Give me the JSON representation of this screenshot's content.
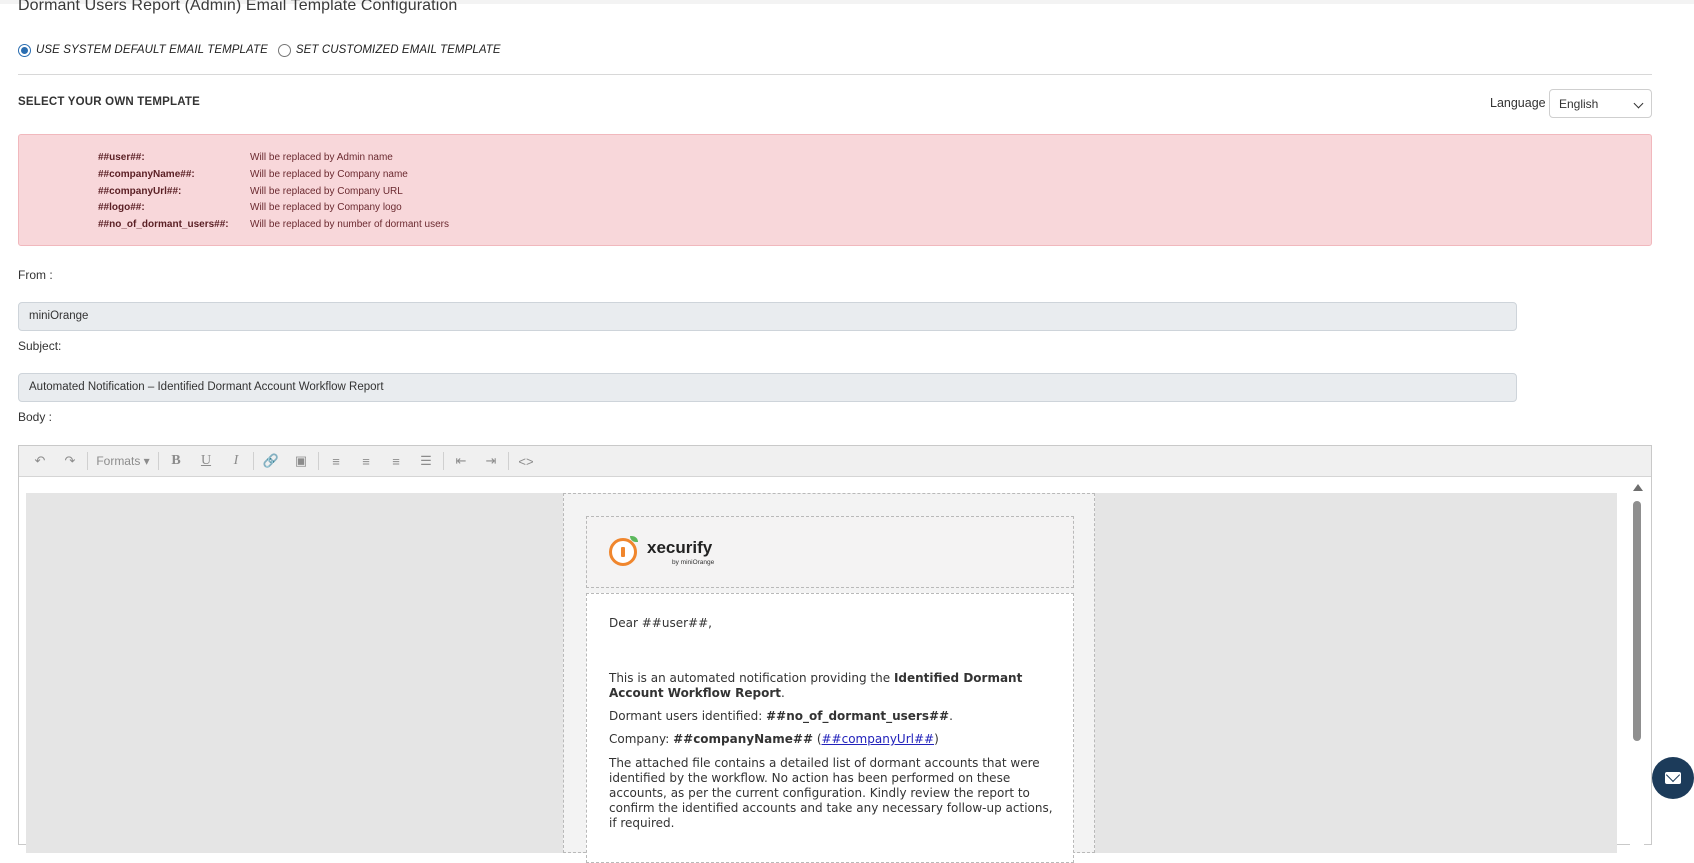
{
  "page": {
    "title": "Dormant Users Report (Admin) Email Template Configuration"
  },
  "template_mode": {
    "options": [
      {
        "label": "USE SYSTEM DEFAULT EMAIL TEMPLATE",
        "selected": true
      },
      {
        "label": "SET CUSTOMIZED EMAIL TEMPLATE",
        "selected": false
      }
    ]
  },
  "section": {
    "title": "SELECT YOUR OWN TEMPLATE"
  },
  "language": {
    "label": "Language",
    "value": "English"
  },
  "placeholders": [
    {
      "key": "##user##:",
      "desc": "Will be replaced by Admin name"
    },
    {
      "key": "##companyName##:",
      "desc": "Will be replaced by Company name"
    },
    {
      "key": "##companyUrl##:",
      "desc": "Will be replaced by Company URL"
    },
    {
      "key": "##logo##:",
      "desc": "Will be replaced by Company logo"
    },
    {
      "key": "##no_of_dormant_users##:",
      "desc": "Will be replaced by number of dormant users"
    }
  ],
  "form": {
    "from_label": "From :",
    "from_value": "miniOrange",
    "subject_label": "Subject:",
    "subject_value": "Automated Notification – Identified Dormant Account Workflow Report",
    "body_label": "Body :"
  },
  "toolbar": {
    "formats_label": "Formats",
    "icons": [
      "undo-icon",
      "redo-icon",
      "bold-icon",
      "underline-icon",
      "italic-icon",
      "link-icon",
      "image-icon",
      "align-left-icon",
      "align-center-icon",
      "align-right-icon",
      "align-justify-icon",
      "outdent-icon",
      "indent-icon",
      "source-code-icon"
    ]
  },
  "email": {
    "logo_text": "xecurify",
    "logo_sub": "by miniOrange",
    "greeting": "Dear ##user##,",
    "intro_text": "This is an automated notification providing the ",
    "intro_bold": "Identified Dormant Account Workflow Report",
    "intro_end": ".",
    "count_text": "Dormant users identified: ",
    "count_bold": "##no_of_dormant_users##",
    "count_end": ".",
    "company_text": "Company: ",
    "company_bold": "##companyName##",
    "company_link": "##companyUrl##",
    "paragraph": "The attached file contains a detailed list of dormant accounts that were identified by the workflow. No action has been performed on these accounts, as per the current configuration. Kindly review the report to confirm the identified accounts and take any necessary follow-up actions, if required."
  },
  "colors": {
    "alert_bg": "#f8d7da",
    "radio_accent": "#2a6db0",
    "chat_bg": "#1c3b5a",
    "logo_orange": "#f0862d"
  }
}
